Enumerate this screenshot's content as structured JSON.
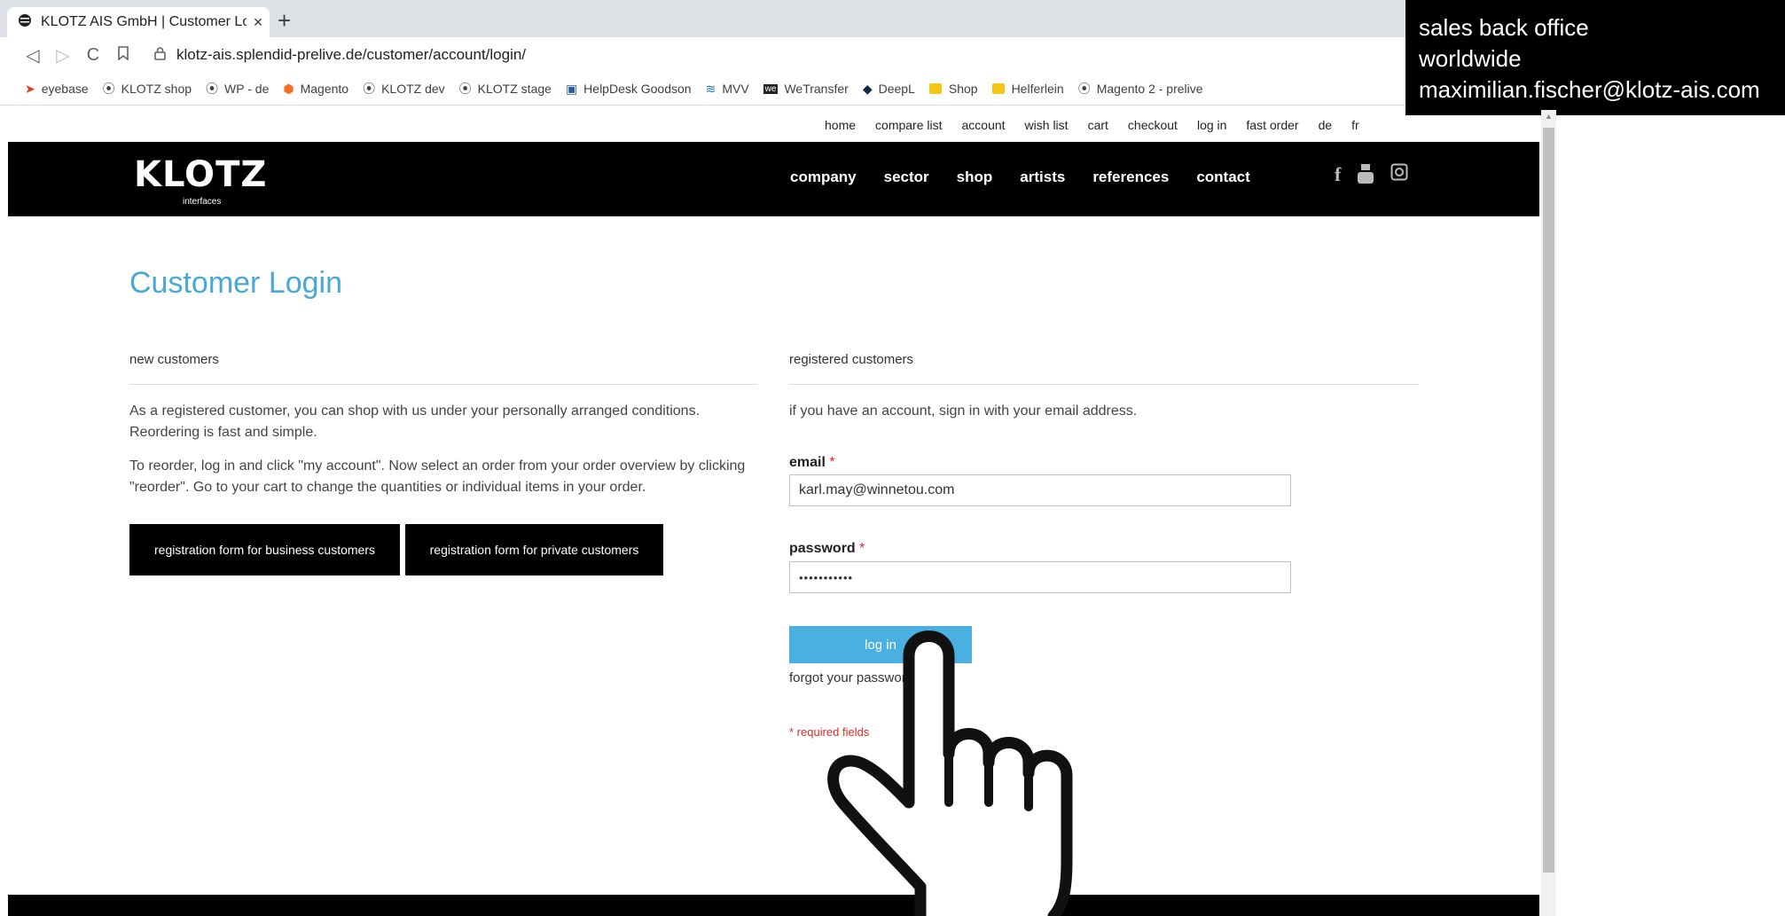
{
  "browser": {
    "tab_title": "KLOTZ AIS GmbH | Customer Login",
    "tab_close": "×",
    "new_tab": "+",
    "url": "klotz-ais.splendid-prelive.de/customer/account/login/",
    "bookmarks": [
      {
        "label": "eyebase",
        "icon": "eyebase-icon"
      },
      {
        "label": "KLOTZ shop",
        "icon": "klotz-icon"
      },
      {
        "label": "WP - de",
        "icon": "klotz-icon"
      },
      {
        "label": "Magento",
        "icon": "magento-icon"
      },
      {
        "label": "KLOTZ dev",
        "icon": "klotz-icon"
      },
      {
        "label": "KLOTZ stage",
        "icon": "klotz-icon"
      },
      {
        "label": "HelpDesk Goodson",
        "icon": "helpdesk-icon"
      },
      {
        "label": "MVV",
        "icon": "mvv-icon"
      },
      {
        "label": "WeTransfer",
        "icon": "wetransfer-icon"
      },
      {
        "label": "DeepL",
        "icon": "deepl-icon"
      },
      {
        "label": "Shop",
        "icon": "folder-icon"
      },
      {
        "label": "Helferlein",
        "icon": "folder-icon"
      },
      {
        "label": "Magento 2 - prelive",
        "icon": "klotz-icon"
      }
    ]
  },
  "overlay": {
    "line1": "sales back office",
    "line2": "worldwide",
    "line3": "maximilian.fischer@klotz-ais.com"
  },
  "site": {
    "top_nav": [
      "home",
      "compare list",
      "account",
      "wish list",
      "cart",
      "checkout",
      "log in",
      "fast order",
      "de",
      "fr"
    ],
    "logo_text": "KLOTZ",
    "logo_sub": "interfaces",
    "main_nav": [
      "company",
      "sector",
      "shop",
      "artists",
      "references",
      "contact"
    ],
    "page_title": "Customer Login",
    "new_customers": {
      "heading": "new customers",
      "para1": "As a registered customer, you can shop with us under your personally arranged conditions. Reordering is fast and simple.",
      "para2": "To reorder, log in and click \"my account\". Now select an order from your order overview by clicking \"reorder\". Go to your cart to change the quantities or individual items in your order.",
      "btn_business": "registration form for business customers",
      "btn_private": "registration form for private customers"
    },
    "registered_customers": {
      "heading": "registered customers",
      "intro": "if you have an account, sign in with your email address.",
      "email_label": "email",
      "email_value": "karl.may@winnetou.com",
      "password_label": "password",
      "password_value": "•••••••••••",
      "required_mark": "*",
      "login_button": "log in",
      "forgot_link": "forgot your password?",
      "required_note": "* required fields"
    }
  },
  "colors": {
    "accent": "#4aa8d6",
    "button": "#4ab0e1",
    "header_bg": "#000000",
    "required": "#e02b27"
  }
}
